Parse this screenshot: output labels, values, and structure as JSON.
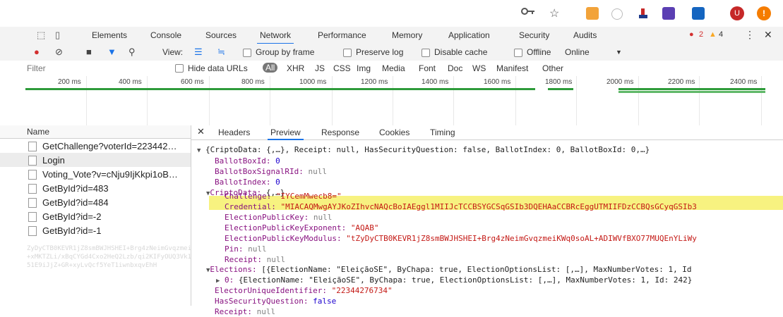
{
  "browser": {
    "icons": [
      "key-icon",
      "star-icon",
      "extension-orange-icon",
      "extension-circle-icon",
      "extension-flag-icon",
      "extension-purple-icon",
      "extension-blue-icon",
      "profile-avatar",
      "alert-icon"
    ],
    "avatar_letter": "U",
    "alert_glyph": "!"
  },
  "devtools": {
    "tabs": [
      "Elements",
      "Console",
      "Sources",
      "Network",
      "Performance",
      "Memory",
      "Application",
      "Security",
      "Audits"
    ],
    "active_tab": "Network",
    "errors": "2",
    "warnings": "4"
  },
  "toolbar": {
    "view_label": "View:",
    "group_by_frame": "Group by frame",
    "preserve_log": "Preserve log",
    "disable_cache": "Disable cache",
    "offline": "Offline",
    "throttle": "Online"
  },
  "filter": {
    "placeholder": "Filter",
    "hide_data_urls": "Hide data URLs",
    "types": [
      "All",
      "XHR",
      "JS",
      "CSS",
      "Img",
      "Media",
      "Font",
      "Doc",
      "WS",
      "Manifest",
      "Other"
    ]
  },
  "timeline": {
    "ticks": [
      "200 ms",
      "400 ms",
      "600 ms",
      "800 ms",
      "1000 ms",
      "1200 ms",
      "1400 ms",
      "1600 ms",
      "1800 ms",
      "2000 ms",
      "2200 ms",
      "2400 ms"
    ]
  },
  "requests": {
    "header": "Name",
    "items": [
      "GetChallenge?voterId=223442…",
      "Login",
      "Voting_Vote?v=cNju9IjKkpi1oB…",
      "GetById?id=483",
      "GetById?id=484",
      "GetById?id=-2",
      "GetById?id=-1"
    ]
  },
  "detail": {
    "tabs": [
      "Headers",
      "Preview",
      "Response",
      "Cookies",
      "Timing"
    ],
    "active": "Preview",
    "lines": {
      "root": "{CriptoData: {,…}, Receipt: null, HasSecurityQuestion: false, BallotIndex: 0, BallotBoxId: 0,…}",
      "ballotBoxId_k": "BallotBoxId:",
      "ballotBoxId_v": "0",
      "ballotBoxSignalRId_k": "BallotBoxSignalRId:",
      "ballotBoxSignalRId_v": "null",
      "ballotIndex_k": "BallotIndex:",
      "ballotIndex_v": "0",
      "criptoData_k": "CriptoData:",
      "criptoData_v": "{,…}",
      "challenge_k": "Challenge:",
      "challenge_v": "\"IYCemMwecb8=\"",
      "credential_k": "Credential:",
      "credential_v": "\"MIACAQMwgAYJKoZIhvcNAQcBoIAEggl1MIIJcTCCBSYGCSqGSIb3DQEHAaCCBRcEggUTMIIFDzCCBQsGCyqGSIb3",
      "epk_k": "ElectionPublicKey:",
      "epk_v": "null",
      "epke_k": "ElectionPublicKeyExponent:",
      "epke_v": "\"AQAB\"",
      "epkm_k": "ElectionPublicKeyModulus:",
      "epkm_v": "\"tZyDyCTB0KEVR1jZ8smBWJHSHEI+Brg4zNeimGvqzmeiKWq0soAL+ADIWVfBXO77MUQEnYLiWy",
      "pin_k": "Pin:",
      "pin_v": "null",
      "receipt1_k": "Receipt:",
      "receipt1_v": "null",
      "elections_k": "Elections:",
      "elections_v": "[{ElectionName: \"EleiçãoSE\", ByChapa: true, ElectionOptionsList: [,…], MaxNumberVotes: 1, Id",
      "el0_k": "0:",
      "el0_v": "{ElectionName: \"EleiçãoSE\", ByChapa: true, ElectionOptionsList: [,…], MaxNumberVotes: 1, Id: 242}",
      "euid_k": "ElectorUniqueIdentifier:",
      "euid_v": "\"22344276734\"",
      "hsq_k": "HasSecurityQuestion:",
      "hsq_v": "false",
      "receipt2_k": "Receipt:",
      "receipt2_v": "null"
    }
  }
}
